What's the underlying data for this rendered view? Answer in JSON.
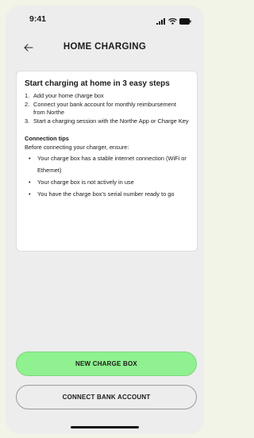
{
  "status_bar": {
    "time": "9:41",
    "icons": [
      "signal-icon",
      "wifi-icon",
      "battery-icon"
    ]
  },
  "header": {
    "back_icon": "arrow-left-icon",
    "title": "HOME CHARGING"
  },
  "card": {
    "heading": "Start charging at home in 3 easy steps",
    "steps": [
      {
        "num": "1.",
        "text": "Add your home charge box"
      },
      {
        "num": "2.",
        "text": "Connect your bank account for monthly reimbursement from Northe"
      },
      {
        "num": "3.",
        "text": "Start a charging session with the Northe App or Charge Key"
      }
    ],
    "tips_title": "Connection tips",
    "tips_intro": "Before connecting your charger, ensure:",
    "tips": [
      "Your charge box has a stable internet connection (WiFi or Ethernet)",
      "Your charge box is not actively in use",
      "You have the charge box's serial number ready to go"
    ]
  },
  "buttons": {
    "primary": "NEW CHARGE BOX",
    "secondary": "CONNECT BANK ACCOUNT"
  },
  "colors": {
    "background": "#ededed",
    "card": "#ffffff",
    "primary_button": "#8ff18f",
    "outer_background": "#f1f4e6"
  }
}
